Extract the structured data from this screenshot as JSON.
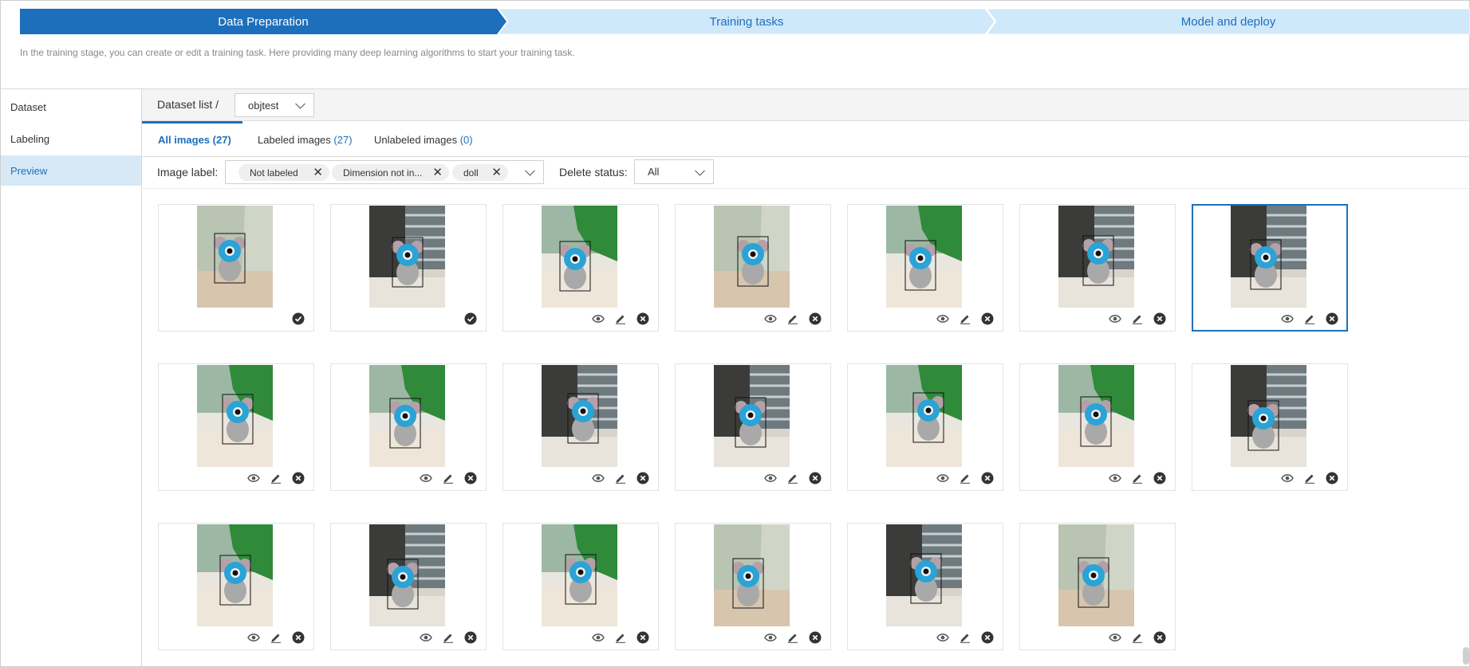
{
  "steps": [
    {
      "label": "Data Preparation",
      "active": true
    },
    {
      "label": "Training tasks",
      "active": false
    },
    {
      "label": "Model and deploy",
      "active": false
    }
  ],
  "description": "In the training stage, you can create or edit a training task. Here providing many deep learning algorithms to start your training task.",
  "sidebar": {
    "items": [
      {
        "label": "Dataset",
        "active": false
      },
      {
        "label": "Labeling",
        "active": false
      },
      {
        "label": "Preview",
        "active": true
      }
    ]
  },
  "breadcrumb": {
    "label": "Dataset list /",
    "dataset_value": "objtest"
  },
  "tabs": [
    {
      "label": "All images",
      "count": "(27)",
      "active": true
    },
    {
      "label": "Labeled images",
      "count": "(27)",
      "active": false
    },
    {
      "label": "Unlabeled images",
      "count": "(0)",
      "active": false
    }
  ],
  "filters": {
    "image_label": "Image label:",
    "tags": [
      "Not labeled",
      "Dimension not in...",
      "doll"
    ],
    "delete_status_label": "Delete status:",
    "delete_status_value": "All"
  },
  "icons": {
    "view": "eye-icon",
    "edit": "pencil-icon",
    "delete": "close-circle-icon",
    "labeled": "check-circle-icon"
  },
  "colors": {
    "accent": "#1d6fbb",
    "step_inactive": "#cfe8fa",
    "selected_tab_bg": "#d7e9f6"
  },
  "images": [
    {
      "bg": "corner",
      "action": "check"
    },
    {
      "bg": "window",
      "action": "check"
    },
    {
      "bg": "green",
      "action": "full"
    },
    {
      "bg": "corner",
      "action": "full"
    },
    {
      "bg": "green",
      "action": "full"
    },
    {
      "bg": "window",
      "action": "full"
    },
    {
      "bg": "window",
      "action": "full",
      "selected": true
    },
    {
      "bg": "green",
      "action": "full"
    },
    {
      "bg": "green",
      "action": "full"
    },
    {
      "bg": "window",
      "action": "full"
    },
    {
      "bg": "window",
      "action": "full"
    },
    {
      "bg": "green",
      "action": "full"
    },
    {
      "bg": "green",
      "action": "full"
    },
    {
      "bg": "window",
      "action": "full"
    },
    {
      "bg": "green",
      "action": "full"
    },
    {
      "bg": "window",
      "action": "full"
    },
    {
      "bg": "green",
      "action": "full"
    },
    {
      "bg": "corner",
      "action": "full"
    },
    {
      "bg": "window",
      "action": "full"
    },
    {
      "bg": "corner",
      "action": "full"
    }
  ]
}
